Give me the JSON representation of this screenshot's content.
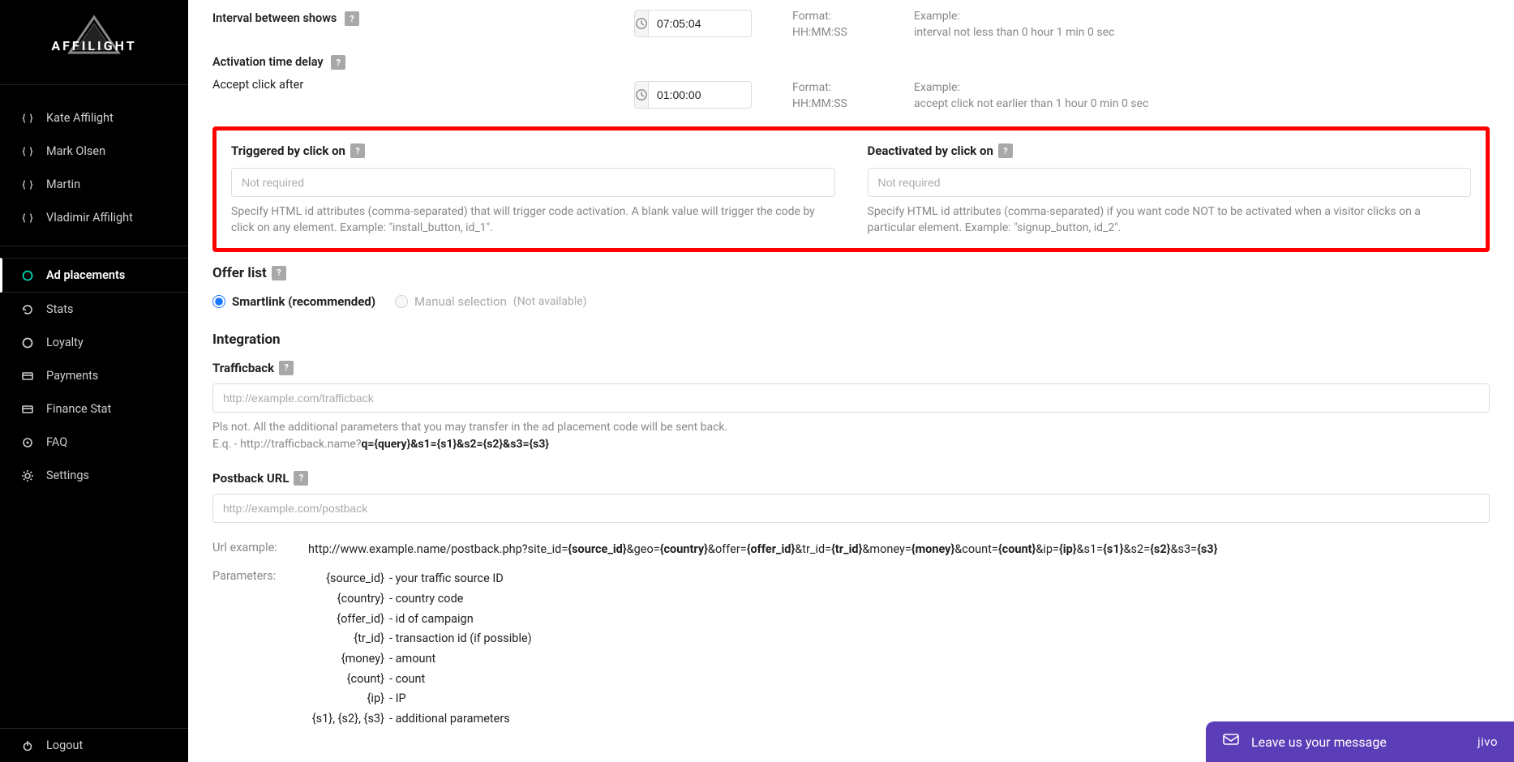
{
  "brand": "AFFILIGHT",
  "sidebar": {
    "users": [
      {
        "label": "Kate Affilight"
      },
      {
        "label": "Mark Olsen"
      },
      {
        "label": "Martin"
      },
      {
        "label": "Vladimir Affilight"
      }
    ],
    "menu": [
      {
        "label": "Ad placements",
        "icon": "circle",
        "active": true
      },
      {
        "label": "Stats",
        "icon": "refresh"
      },
      {
        "label": "Loyalty",
        "icon": "circle-outline"
      },
      {
        "label": "Payments",
        "icon": "card"
      },
      {
        "label": "Finance Stat",
        "icon": "card"
      },
      {
        "label": "FAQ",
        "icon": "target"
      },
      {
        "label": "Settings",
        "icon": "gear"
      }
    ],
    "logout": "Logout"
  },
  "intervalRow": {
    "label": "Interval between shows",
    "value": "07:05:04",
    "formatHead": "Format:",
    "format": "HH:MM:SS",
    "exampleHead": "Example:",
    "example": "interval not less than 0 hour 1 min 0 sec"
  },
  "activationRow": {
    "label": "Activation time delay",
    "sublabel": "Accept click after",
    "value": "01:00:00",
    "formatHead": "Format:",
    "format": "HH:MM:SS",
    "exampleHead": "Example:",
    "example": "accept click not earlier than 1 hour 0 min 0 sec"
  },
  "triggered": {
    "title": "Triggered by click on",
    "placeholder": "Not required",
    "hint": "Specify HTML id attributes (comma-separated) that will trigger code activation. A blank value will trigger the code by click on any element. Example: \"install_button, id_1\"."
  },
  "deactivated": {
    "title": "Deactivated by click on",
    "placeholder": "Not required",
    "hint": "Specify HTML id attributes (comma-separated) if you want code NOT to be activated when a visitor clicks on a particular element. Example: \"signup_button, id_2\"."
  },
  "offerList": {
    "heading": "Offer list",
    "option1": "Smartlink (recommended)",
    "option2": "Manual selection",
    "option2note": "(Not available)"
  },
  "integration": {
    "heading": "Integration",
    "trafficback": {
      "label": "Trafficback",
      "placeholder": "http://example.com/trafficback",
      "noteLine1": "Pls not. All the additional parameters that you may transfer in the ad placement code will be sent back.",
      "noteLine2Pre": "E.q. - http://trafficback.name?",
      "noteLine2Bold": "q={query}&s1={s1}&s2={s2}&s3={s3}"
    },
    "postback": {
      "label": "Postback URL",
      "placeholder": "http://example.com/postback"
    },
    "urlExample": {
      "label": "Url example:",
      "parts": [
        {
          "t": "http://www.example.name/postback.php?site_id=",
          "b": false
        },
        {
          "t": "{source_id}",
          "b": true
        },
        {
          "t": "&geo=",
          "b": false
        },
        {
          "t": "{country}",
          "b": true
        },
        {
          "t": "&offer=",
          "b": false
        },
        {
          "t": "{offer_id}",
          "b": true
        },
        {
          "t": "&tr_id=",
          "b": false
        },
        {
          "t": "{tr_id}",
          "b": true
        },
        {
          "t": "&money=",
          "b": false
        },
        {
          "t": "{money}",
          "b": true
        },
        {
          "t": "&count=",
          "b": false
        },
        {
          "t": "{count}",
          "b": true
        },
        {
          "t": "&ip=",
          "b": false
        },
        {
          "t": "{ip}",
          "b": true
        },
        {
          "t": "&s1=",
          "b": false
        },
        {
          "t": "{s1}",
          "b": true
        },
        {
          "t": "&s2=",
          "b": false
        },
        {
          "t": "{s2}",
          "b": true
        },
        {
          "t": "&s3=",
          "b": false
        },
        {
          "t": "{s3}",
          "b": true
        }
      ]
    },
    "parameters": {
      "label": "Parameters:",
      "items": [
        {
          "k": "{source_id}",
          "d": " - your traffic source ID"
        },
        {
          "k": "{country}",
          "d": " - country code"
        },
        {
          "k": "{offer_id}",
          "d": " - id of campaign"
        },
        {
          "k": "{tr_id}",
          "d": " - transaction id (if possible)"
        },
        {
          "k": "{money}",
          "d": " - amount"
        },
        {
          "k": "{count}",
          "d": " - count"
        },
        {
          "k": "{ip}",
          "d": " - IP"
        },
        {
          "k": "{s1}, {s2}, {s3}",
          "d": " - additional parameters"
        }
      ]
    }
  },
  "chat": {
    "text": "Leave us your message",
    "brand": "jivo"
  }
}
